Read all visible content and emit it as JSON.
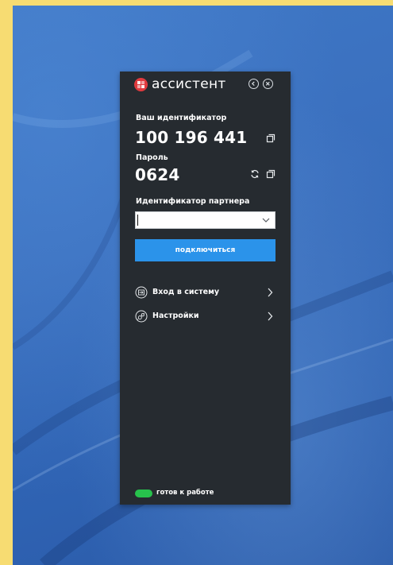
{
  "app": {
    "title": "ассистент",
    "brand_color": "#e03a3e"
  },
  "session": {
    "id_label": "Ваш идентификатор",
    "id_value": "100 196 441",
    "password_label": "Пароль",
    "password_value": "0624"
  },
  "partner": {
    "label": "Идентификатор партнера",
    "value": "",
    "placeholder": ""
  },
  "connect_button": {
    "label": "подключиться",
    "color": "#2b93ea"
  },
  "menu": [
    {
      "label": "Вход в систему",
      "icon": "login-icon"
    },
    {
      "label": "Настройки",
      "icon": "settings-icon"
    }
  ],
  "status": {
    "text": "готов к работе",
    "color": "#27c24c"
  }
}
